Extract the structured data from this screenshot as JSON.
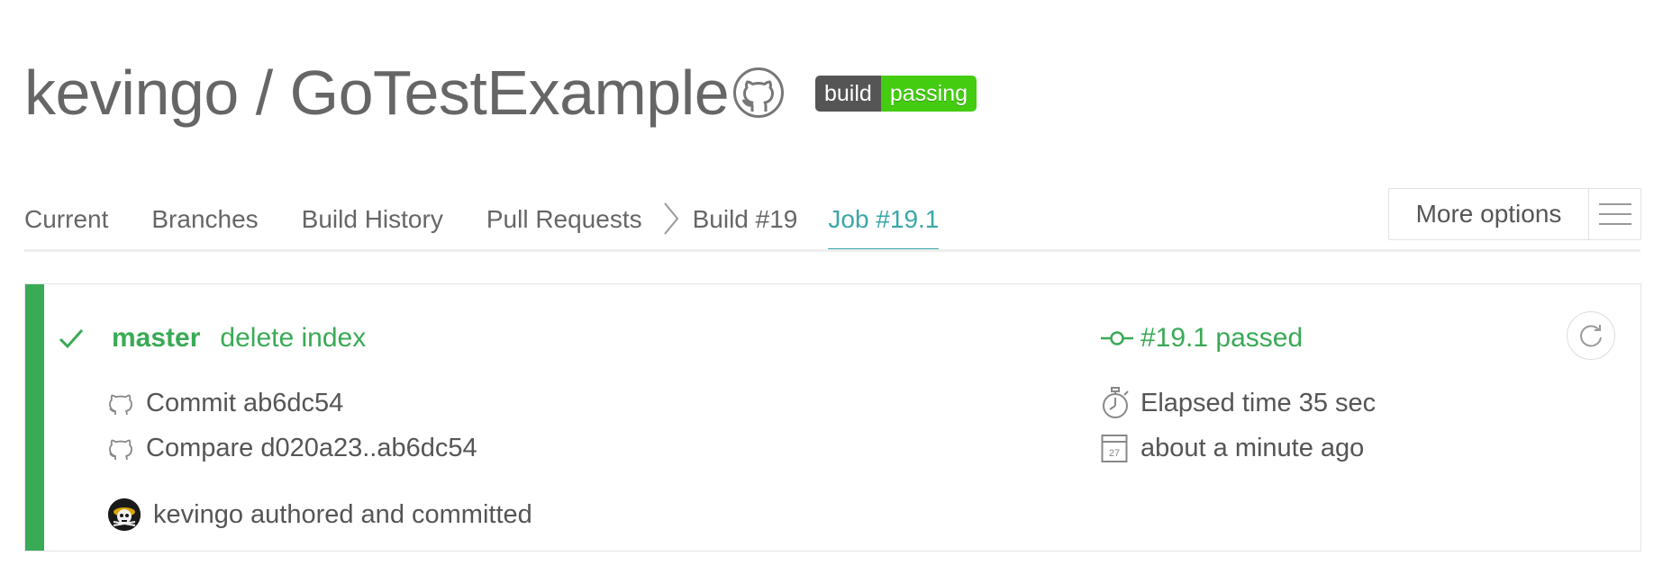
{
  "header": {
    "repo_title": "kevingo / GoTestExample",
    "badge_left": "build",
    "badge_right": "passing",
    "badge_colors": {
      "left": "#555555",
      "right": "#44cc11"
    }
  },
  "tabs": [
    {
      "label": "Current"
    },
    {
      "label": "Branches"
    },
    {
      "label": "Build History"
    },
    {
      "label": "Pull Requests"
    },
    {
      "label": "Build #19"
    },
    {
      "label": "Job #19.1",
      "active": true
    }
  ],
  "more_options": {
    "label": "More options",
    "icon": "hamburger-icon"
  },
  "job": {
    "status_color": "#39aa56",
    "branch": "master",
    "message": "delete index",
    "status_text": "#19.1 passed",
    "commit": "Commit ab6dc54",
    "compare": "Compare d020a23..ab6dc54",
    "elapsed": "Elapsed time 35 sec",
    "finished": "about a minute ago",
    "calendar_day": "27",
    "author": "kevingo authored and committed"
  },
  "accent_color": "#3aa7a7"
}
